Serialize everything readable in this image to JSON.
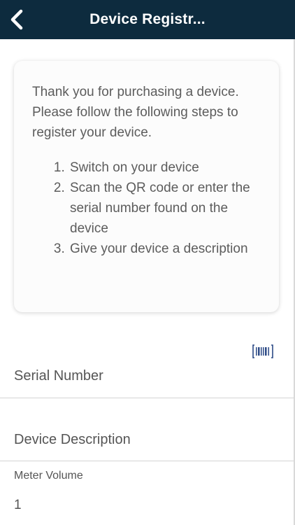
{
  "header": {
    "title": "Device Registr...",
    "background_color": "#0d2b3e",
    "back_icon": "chevron-left-icon"
  },
  "instructions": {
    "intro": "Thank you for purchasing a device. Please follow the following steps to register your device.",
    "steps": [
      "Switch on your device",
      "Scan the QR code or enter the serial number found on the device",
      "Give your device a description"
    ]
  },
  "form": {
    "scan_icon": "barcode-scan-icon",
    "serial_number": {
      "placeholder": "Serial Number"
    },
    "device_description": {
      "placeholder": "Device Description"
    },
    "meter_volume": {
      "label": "Meter Volume",
      "value": "1"
    }
  }
}
